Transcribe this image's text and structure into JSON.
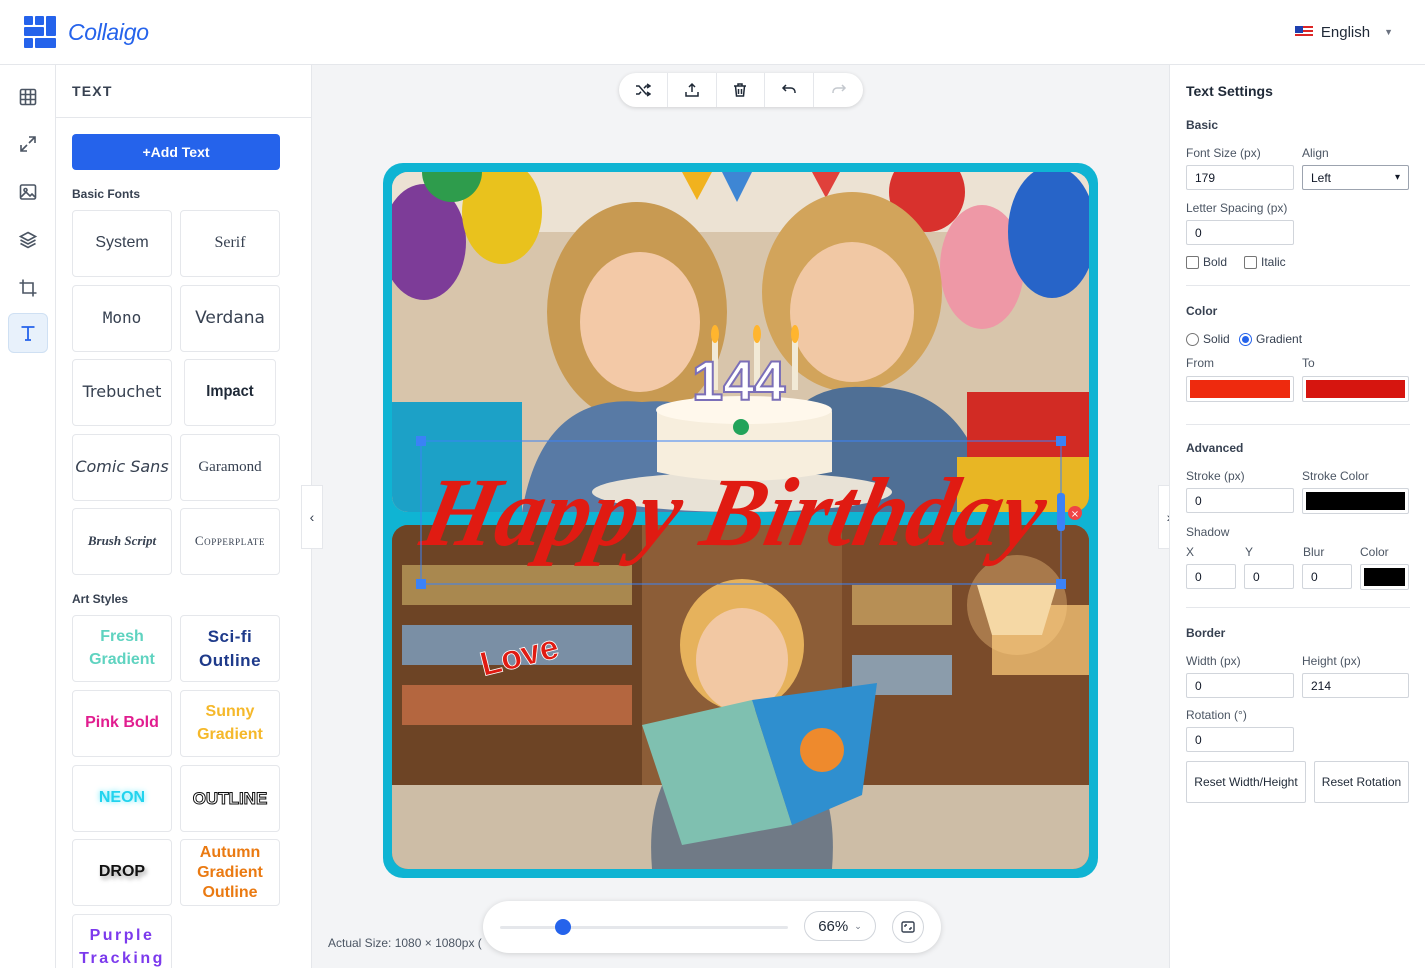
{
  "header": {
    "brand": "Collaigo",
    "language": "English"
  },
  "rail": {
    "items": [
      {
        "name": "grid-layout"
      },
      {
        "name": "resize"
      },
      {
        "name": "image"
      },
      {
        "name": "layers"
      },
      {
        "name": "crop"
      },
      {
        "name": "text"
      }
    ],
    "active": "text"
  },
  "text_panel": {
    "title": "TEXT",
    "add_button": "+Add Text",
    "basic_fonts_label": "Basic Fonts",
    "basic_fonts": [
      "System",
      "Serif",
      "Mono",
      "Verdana",
      "Trebuchet",
      "Impact",
      "Comic Sans",
      "Garamond",
      "Brush Script",
      "Copperplate"
    ],
    "art_styles_label": "Art Styles",
    "art_styles": [
      "Fresh Gradient",
      "Sci-fi Outline",
      "Pink Bold",
      "Sunny Gradient",
      "NEON",
      "OUTLINE",
      "DROP",
      "Autumn Gradient Outline",
      "Purple Tracking"
    ]
  },
  "canvas": {
    "headline_text": "Happy Birthday",
    "small_text": "Love",
    "candle_text": "144",
    "headline_color": "#e01b12",
    "frame_color": "#0fb4d3",
    "actual_size": "Actual Size: 1080 × 1080px (",
    "zoom": "66%",
    "zoom_level": 0.22
  },
  "settings": {
    "title": "Text Settings",
    "basic_heading": "Basic",
    "font_size_label": "Font Size (px)",
    "font_size": "179",
    "align_label": "Align",
    "align": "Left",
    "letter_spacing_label": "Letter Spacing (px)",
    "letter_spacing": "0",
    "bold_label": "Bold",
    "italic_label": "Italic",
    "color_heading": "Color",
    "solid_label": "Solid",
    "gradient_label": "Gradient",
    "from_label": "From",
    "to_label": "To",
    "from_color": "#ee2a0e",
    "to_color": "#d6150f",
    "advanced_heading": "Advanced",
    "stroke_label": "Stroke (px)",
    "stroke": "0",
    "stroke_color_label": "Stroke Color",
    "stroke_color": "#000000",
    "shadow_label": "Shadow",
    "shadow_x_label": "X",
    "shadow_x": "0",
    "shadow_y_label": "Y",
    "shadow_y": "0",
    "shadow_blur_label": "Blur",
    "shadow_blur": "0",
    "shadow_color_label": "Color",
    "shadow_color": "#000000",
    "border_heading": "Border",
    "width_label": "Width (px)",
    "width": "0",
    "height_label": "Height (px)",
    "height": "214",
    "rotation_label": "Rotation (°)",
    "rotation": "0",
    "reset_wh": "Reset Width/Height",
    "reset_rotation": "Reset Rotation"
  }
}
